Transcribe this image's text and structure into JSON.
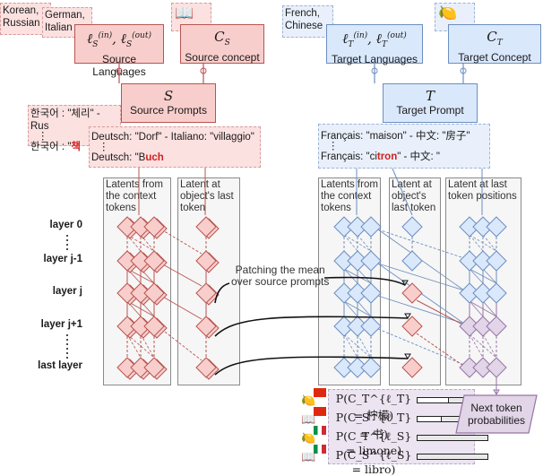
{
  "colors": {
    "source_fill": "#f8cecc",
    "source_stroke": "#b85450",
    "target_fill": "#dae8fc",
    "target_stroke": "#6c8ebf",
    "patched_fill": "#e1d5e7",
    "patched_stroke": "#9673a6",
    "highlight": "#d21f1f"
  },
  "source": {
    "languages_note": [
      "Korean,",
      "Russian"
    ],
    "languages_note2": [
      "German,",
      "Italian"
    ],
    "concept_icon": "book-icon",
    "lang_box": {
      "math": "ℓ_S^(in), ℓ_S^(out)",
      "label": "Source Languages"
    },
    "concept_box": {
      "math": "C_S",
      "label": "Source concept"
    },
    "prompts_box": {
      "math": "S",
      "label": "Source Prompts"
    },
    "prompt_examples_ko": {
      "line1": "한국어 : \"체리\" - Rus",
      "dots": "⋮",
      "line3_prefix": "한국어 : \"",
      "line3_hl": "책"
    },
    "prompt_examples_de": {
      "line1": "Deutsch: \"Dorf\" - Italiano: \"villaggio\"",
      "dots": "⋮",
      "line3_prefix": "Deutsch: \"B",
      "line3_hl": "uch"
    }
  },
  "target": {
    "languages_note": [
      "French,",
      "Chinese"
    ],
    "concept_icon": "lemon-icon",
    "lang_box": {
      "math": "ℓ_T^(in), ℓ_T^(out)",
      "label": "Target Languages"
    },
    "concept_box": {
      "math": "C_T",
      "label": "Target Concept"
    },
    "prompt_box": {
      "math": "T",
      "label": "Target Prompt"
    },
    "prompt_examples": {
      "line1": "Français: \"maison\" - 中文: \"房子\"",
      "dots": "⋮",
      "line3_prefix": "Français: \"ci",
      "line3_hl": "tron",
      "line3_suffix": "\" - 中文: \""
    }
  },
  "panels": {
    "src_context": "Latents from the context tokens",
    "src_object": "Latent at object's last token",
    "tgt_context": "Latents from the context tokens",
    "tgt_object": "Latent at object's last token",
    "tgt_last": "Latent at last token positions"
  },
  "layers": [
    {
      "label": "layer 0"
    },
    {
      "label": "layer j-1"
    },
    {
      "label": "layer j"
    },
    {
      "label": "layer j+1"
    },
    {
      "label": "last layer"
    }
  ],
  "annotation": {
    "line1": "Patching the mean",
    "line2": "over source prompts"
  },
  "output": {
    "label_line1": "Next token",
    "label_line2": "probabilities",
    "rows": [
      {
        "icon": "lemon-icon",
        "flag": "china-flag",
        "formula": "P(C_T^{ℓ_T} = 柠檬)",
        "prob": 0.45
      },
      {
        "icon": "book-icon",
        "flag": "china-flag",
        "formula": "P(C_S^{ℓ_T} = 书)",
        "prob": 0.35
      },
      {
        "icon": "lemon-icon",
        "flag": "italy-flag",
        "formula": "P(C_T^{ℓ_S} = limone)",
        "prob": 0.0
      },
      {
        "icon": "book-icon",
        "flag": "italy-flag",
        "formula": "P(C_S^{ℓ_S} = libro)",
        "prob": 0.0
      }
    ]
  }
}
